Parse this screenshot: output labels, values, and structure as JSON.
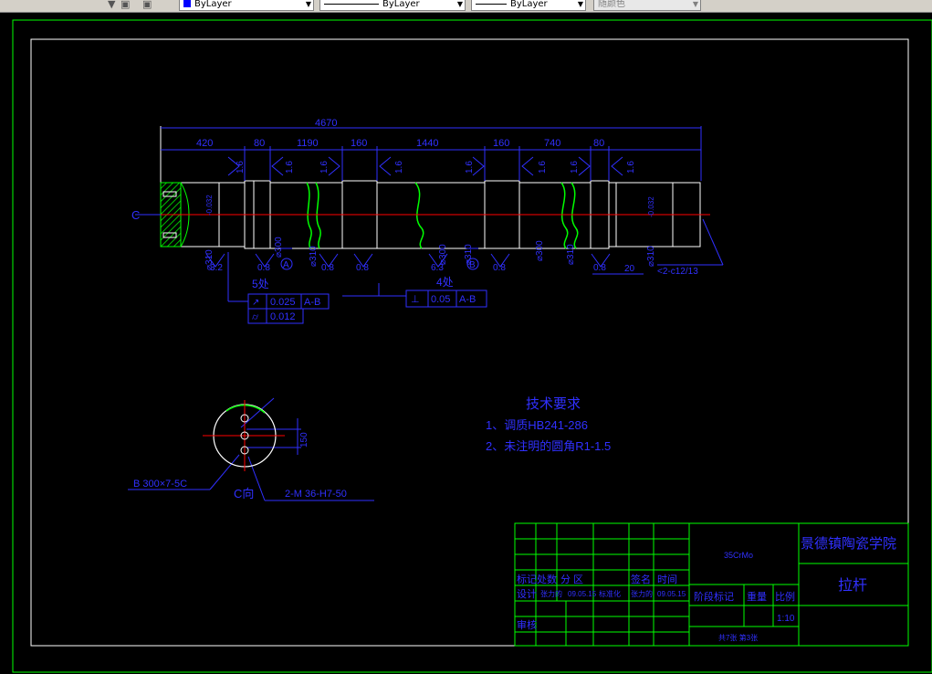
{
  "toolbar": {
    "color_control": "ByLayer",
    "linetype_control": "ByLayer",
    "lineweight_control": "ByLayer",
    "plotstyle_control": "随颜色"
  },
  "drawing": {
    "dims": {
      "overall": "4670",
      "seg1": "420",
      "seg2": "80",
      "seg3": "1190",
      "seg4": "160",
      "seg5": "1440",
      "seg6": "160",
      "seg7": "740",
      "seg8": "80"
    },
    "roughness": {
      "r16": "1.6",
      "r32": "3.2",
      "r08": "0.8",
      "r63": "6.3"
    },
    "diameters": {
      "d1": "⌀310",
      "d2": "⌀300",
      "d3": "⌀310",
      "d4": "⌀300",
      "d5": "⌀310",
      "d6": "⌀300",
      "d7": "⌀310",
      "d8": "⌀310"
    },
    "tolerances": {
      "tol1": "-0.032",
      "tol2": "-0.032",
      "tol3": "-0.032"
    },
    "datum_a": "A",
    "datum_b": "B",
    "section_c": "C",
    "chamfer_20": "20",
    "thread_note": "<2-c12/13",
    "gdt": {
      "note5": "5处",
      "note4": "4处",
      "frame1_val": "0.025",
      "frame1_ref": "A-B",
      "frame2_val": "0.012",
      "frame3_val": "0.05",
      "frame3_ref": "A-B"
    },
    "end_view": {
      "dim": "150",
      "spline": "B 300×7-5C",
      "holes": "2-M 36-H7-50",
      "label": "C向"
    },
    "requirements": {
      "title": "技术要求",
      "item1": "1、调质HB241-286",
      "item2": "2、未注明的圆角R1-1.5"
    },
    "title_block": {
      "material": "35CrMo",
      "school": "景德镇陶瓷学院",
      "part_name": "拉杆",
      "row_labels": {
        "mark": "标记",
        "count": "处数",
        "zone": "分 区",
        "sign": "签名",
        "date": "时间",
        "design": "设计",
        "review": "审核"
      },
      "design_name": "张力的",
      "design_date": "09.05.15",
      "std": "标准化",
      "std_name": "张力的",
      "std_date": "09.05.15",
      "stage": "阶段标记",
      "weight": "重量",
      "scale": "比例",
      "scale_value": "1:10",
      "sheets": "共7张 第3张"
    }
  }
}
